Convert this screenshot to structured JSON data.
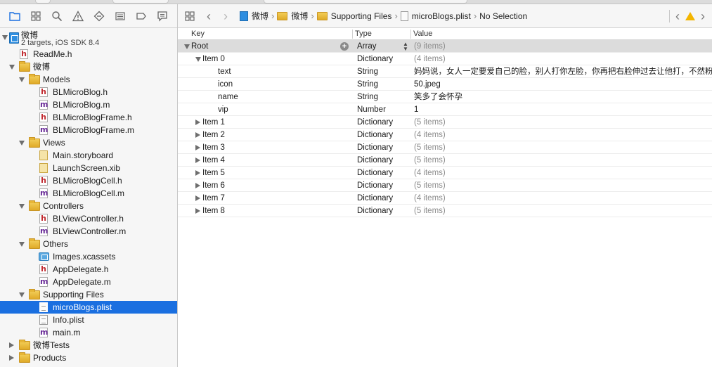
{
  "navigator": {
    "project": {
      "name": "微博",
      "subtitle": "2 targets, iOS SDK 8.4"
    },
    "tree": [
      {
        "label": "ReadMe.h",
        "kind": "h",
        "depth": 1
      },
      {
        "label": "微博",
        "kind": "folder",
        "depth": 1,
        "open": true
      },
      {
        "label": "Models",
        "kind": "folder",
        "depth": 2,
        "open": true
      },
      {
        "label": "BLMicroBlog.h",
        "kind": "h",
        "depth": 3
      },
      {
        "label": "BLMicroBlog.m",
        "kind": "m",
        "depth": 3
      },
      {
        "label": "BLMicroBlogFrame.h",
        "kind": "h",
        "depth": 3
      },
      {
        "label": "BLMicroBlogFrame.m",
        "kind": "m",
        "depth": 3
      },
      {
        "label": "Views",
        "kind": "folder",
        "depth": 2,
        "open": true
      },
      {
        "label": "Main.storyboard",
        "kind": "sb",
        "depth": 3
      },
      {
        "label": "LaunchScreen.xib",
        "kind": "xib",
        "depth": 3
      },
      {
        "label": "BLMicroBlogCell.h",
        "kind": "h",
        "depth": 3
      },
      {
        "label": "BLMicroBlogCell.m",
        "kind": "m",
        "depth": 3
      },
      {
        "label": "Controllers",
        "kind": "folder",
        "depth": 2,
        "open": true
      },
      {
        "label": "BLViewController.h",
        "kind": "h",
        "depth": 3
      },
      {
        "label": "BLViewController.m",
        "kind": "m",
        "depth": 3
      },
      {
        "label": "Others",
        "kind": "folder",
        "depth": 2,
        "open": true
      },
      {
        "label": "Images.xcassets",
        "kind": "assets",
        "depth": 3
      },
      {
        "label": "AppDelegate.h",
        "kind": "h",
        "depth": 3
      },
      {
        "label": "AppDelegate.m",
        "kind": "m",
        "depth": 3
      },
      {
        "label": "Supporting Files",
        "kind": "folder",
        "depth": 2,
        "open": true
      },
      {
        "label": "microBlogs.plist",
        "kind": "plist",
        "depth": 3,
        "selected": true
      },
      {
        "label": "Info.plist",
        "kind": "plist",
        "depth": 3
      },
      {
        "label": "main.m",
        "kind": "m",
        "depth": 3
      },
      {
        "label": "微博Tests",
        "kind": "folder",
        "depth": 1,
        "open": false
      },
      {
        "label": "Products",
        "kind": "folder",
        "depth": 1,
        "open": false
      }
    ]
  },
  "jumpbar": {
    "crumbs": [
      "微博",
      "微博",
      "Supporting Files",
      "microBlogs.plist",
      "No Selection"
    ]
  },
  "plist": {
    "headers": {
      "key": "Key",
      "type": "Type",
      "value": "Value"
    },
    "rows": [
      {
        "key": "Root",
        "type": "Array",
        "value": "(9 items)",
        "depth": 0,
        "state": "open",
        "dim": true,
        "root": true
      },
      {
        "key": "Item 0",
        "type": "Dictionary",
        "value": "(4 items)",
        "depth": 1,
        "state": "open",
        "dim": true
      },
      {
        "key": "text",
        "type": "String",
        "value": "妈妈说，女人一定要爱自己的脸，别人打你左脸，你再把右脸伸过去让他打，不然粉底怎么抹",
        "depth": 2,
        "state": "none",
        "dim": false
      },
      {
        "key": "icon",
        "type": "String",
        "value": "50.jpeg",
        "depth": 2,
        "state": "none",
        "dim": false
      },
      {
        "key": "name",
        "type": "String",
        "value": "笑多了会怀孕",
        "depth": 2,
        "state": "none",
        "dim": false
      },
      {
        "key": "vip",
        "type": "Number",
        "value": "1",
        "depth": 2,
        "state": "none",
        "dim": false
      },
      {
        "key": "Item 1",
        "type": "Dictionary",
        "value": "(5 items)",
        "depth": 1,
        "state": "closed",
        "dim": true
      },
      {
        "key": "Item 2",
        "type": "Dictionary",
        "value": "(4 items)",
        "depth": 1,
        "state": "closed",
        "dim": true
      },
      {
        "key": "Item 3",
        "type": "Dictionary",
        "value": "(5 items)",
        "depth": 1,
        "state": "closed",
        "dim": true
      },
      {
        "key": "Item 4",
        "type": "Dictionary",
        "value": "(5 items)",
        "depth": 1,
        "state": "closed",
        "dim": true
      },
      {
        "key": "Item 5",
        "type": "Dictionary",
        "value": "(4 items)",
        "depth": 1,
        "state": "closed",
        "dim": true
      },
      {
        "key": "Item 6",
        "type": "Dictionary",
        "value": "(5 items)",
        "depth": 1,
        "state": "closed",
        "dim": true
      },
      {
        "key": "Item 7",
        "type": "Dictionary",
        "value": "(4 items)",
        "depth": 1,
        "state": "closed",
        "dim": true
      },
      {
        "key": "Item 8",
        "type": "Dictionary",
        "value": "(5 items)",
        "depth": 1,
        "state": "closed",
        "dim": true
      }
    ]
  },
  "colors": {
    "selection": "#1a6fe0",
    "warning": "#f3b500",
    "header_h": "#c0282e",
    "header_m": "#6a2c98"
  },
  "icons": [
    "project-navigator-icon",
    "symbol-navigator-icon",
    "find-navigator-icon",
    "issue-navigator-icon",
    "test-navigator-icon",
    "debug-navigator-icon",
    "breakpoint-navigator-icon",
    "report-navigator-icon",
    "related-items-icon",
    "back-chevron-icon",
    "forward-chevron-icon",
    "warning-icon"
  ]
}
